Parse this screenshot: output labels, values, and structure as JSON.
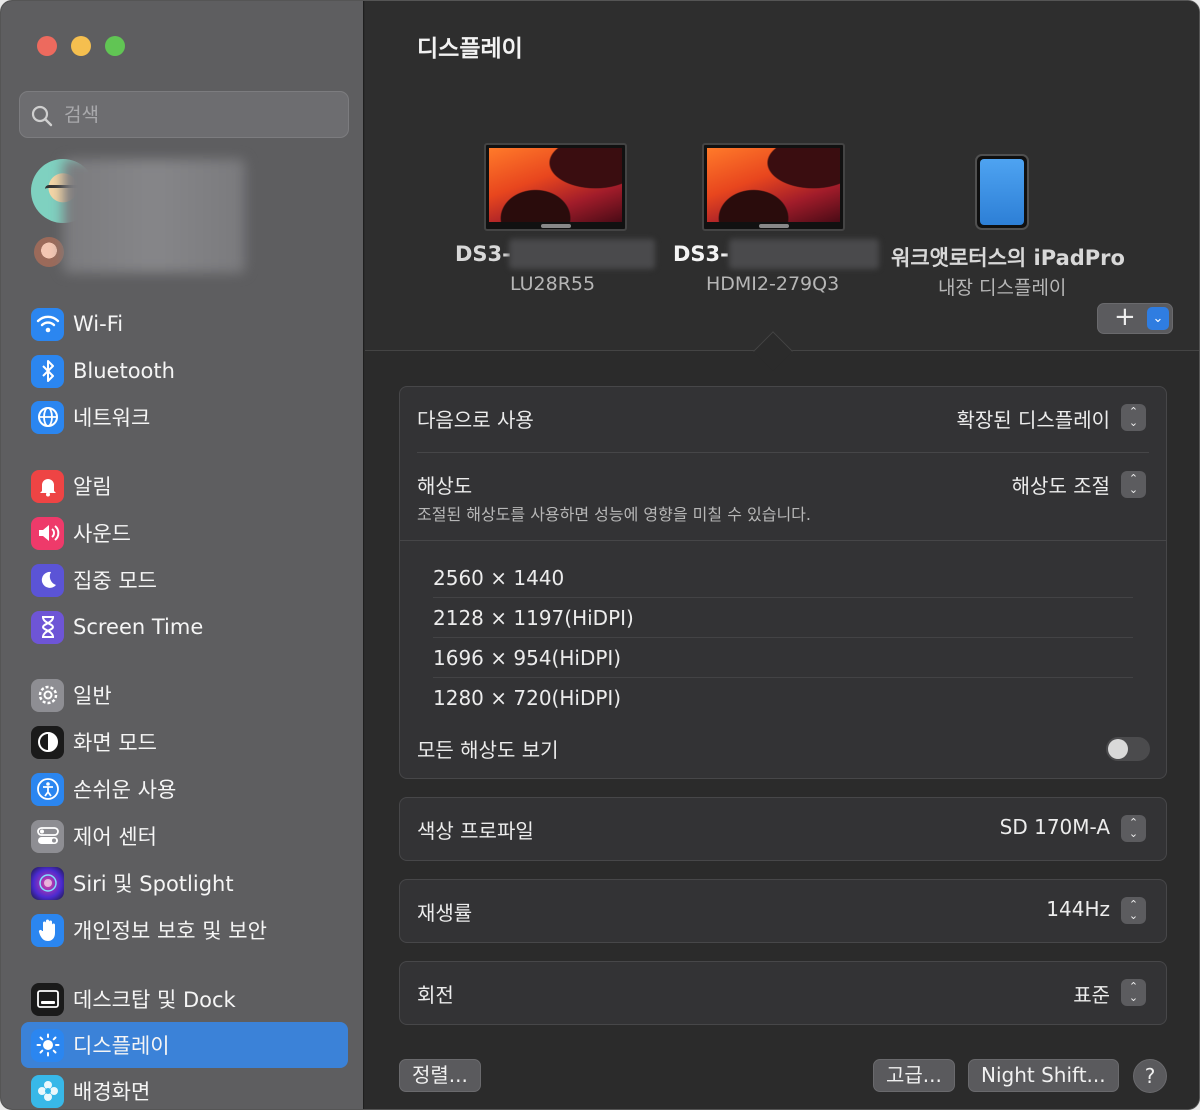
{
  "window": {
    "title": "디스플레이",
    "controls": {
      "close": "#ed6a5e",
      "minimize": "#f5bf4f",
      "zoom": "#61c554"
    }
  },
  "sidebar": {
    "search": {
      "placeholder": "검색"
    },
    "items": [
      {
        "label": "Wi-Fi",
        "icon": "wifi-icon",
        "color": "#2b86f0"
      },
      {
        "label": "Bluetooth",
        "icon": "bluetooth-icon",
        "color": "#2b86f0"
      },
      {
        "label": "네트워크",
        "icon": "globe-icon",
        "color": "#2b86f0"
      },
      {
        "label": "알림",
        "icon": "bell-icon",
        "color": "#ee4444"
      },
      {
        "label": "사운드",
        "icon": "speaker-icon",
        "color": "#ee3a6a"
      },
      {
        "label": "집중 모드",
        "icon": "moon-icon",
        "color": "#5b54d6"
      },
      {
        "label": "Screen Time",
        "icon": "hourglass-icon",
        "color": "#6e55d6"
      },
      {
        "label": "일반",
        "icon": "gear-icon",
        "color": "#8e8e93"
      },
      {
        "label": "화면 모드",
        "icon": "appearance-icon",
        "color": "#1a1a1a"
      },
      {
        "label": "손쉬운 사용",
        "icon": "accessibility-icon",
        "color": "#2b86f0"
      },
      {
        "label": "제어 센터",
        "icon": "control-center-icon",
        "color": "#8e8e93"
      },
      {
        "label": "Siri 및 Spotlight",
        "icon": "siri-icon",
        "color": "#7a3ad6"
      },
      {
        "label": "개인정보 보호 및 보안",
        "icon": "hand-icon",
        "color": "#2b86f0"
      },
      {
        "label": "데스크탑 및 Dock",
        "icon": "dock-icon",
        "color": "#1a1a1a"
      },
      {
        "label": "디스플레이",
        "icon": "sun-icon",
        "color": "#2b86f0",
        "active": true
      },
      {
        "label": "배경화면",
        "icon": "flower-icon",
        "color": "#38b8e8"
      }
    ]
  },
  "displays": [
    {
      "name": "DS3-",
      "subtitle": "LU28R55"
    },
    {
      "name": "DS3-",
      "subtitle": "HDMI2-279Q3"
    },
    {
      "name": "워크앳로터스의 iPadPro",
      "subtitle": "내장 디스플레이"
    }
  ],
  "add_button": {
    "label": "+"
  },
  "settings": {
    "use_as": {
      "label": "다음으로 사용",
      "value": "확장된 디스플레이"
    },
    "resolution": {
      "label": "해상도",
      "value": "해상도 조절",
      "hint": "조절된 해상도를 사용하면 성능에 영향을 미칠 수 있습니다.",
      "options": [
        "2560 × 1440",
        "2128 × 1197(HiDPI)",
        "1696 × 954(HiDPI)",
        "1280 × 720(HiDPI)"
      ],
      "show_all_label": "모든 해상도 보기",
      "show_all": false
    },
    "color_profile": {
      "label": "색상 프로파일",
      "value": "SD 170M-A"
    },
    "refresh_rate": {
      "label": "재생률",
      "value": "144Hz"
    },
    "rotation": {
      "label": "회전",
      "value": "표준"
    }
  },
  "footer": {
    "arrange": "정렬...",
    "advanced": "고급...",
    "night_shift": "Night Shift...",
    "help": "?"
  }
}
